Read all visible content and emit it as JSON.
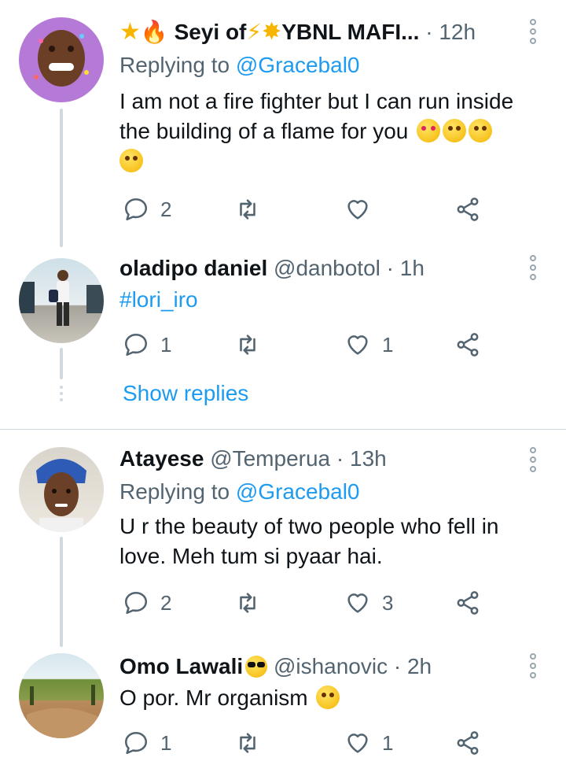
{
  "tweets": [
    {
      "name_prefix": "★ 🔥",
      "name": "Seyi of",
      "name_suffix": "⚡ ✨YBNL MAFI...",
      "time": "· 12h",
      "reply_label": "Replying to",
      "reply_to": "@Gracebal0",
      "text": "I am not a fire fighter but I can run inside the building of a flame for you",
      "emojis": [
        "heart-eyes-emoji",
        "kiss-emoji",
        "party-emoji",
        "smiling-hearts-emoji"
      ],
      "replies": "2",
      "retweets": "",
      "likes": ""
    },
    {
      "name": "oladipo daniel",
      "handle": "@danbotol",
      "time": "· 1h",
      "text": "#lori_iro",
      "replies": "1",
      "retweets": "",
      "likes": "1",
      "show_replies": "Show replies"
    },
    {
      "name": "Atayese",
      "handle": "@Temperua",
      "time": "· 13h",
      "reply_label": "Replying to",
      "reply_to": "@Gracebal0",
      "text": "U r the beauty of two people who fell in love. Meh tum si pyaar hai.",
      "replies": "2",
      "retweets": "",
      "likes": "3"
    },
    {
      "name": "Omo Lawali",
      "name_emoji": "sunglasses-emoji",
      "handle": "@ishanovic",
      "time": "· 2h",
      "text": "O por. Mr organism",
      "emojis": [
        "grinning-emoji"
      ],
      "replies": "1",
      "retweets": "",
      "likes": "1"
    }
  ],
  "icons": {
    "reply": "reply-icon",
    "retweet": "retweet-icon",
    "like": "heart-icon",
    "share": "share-icon",
    "more": "more-vertical-icon"
  },
  "colors": {
    "accent": "#1d9bf0",
    "secondary_text": "#536471",
    "thread_line": "#cfd9de"
  }
}
